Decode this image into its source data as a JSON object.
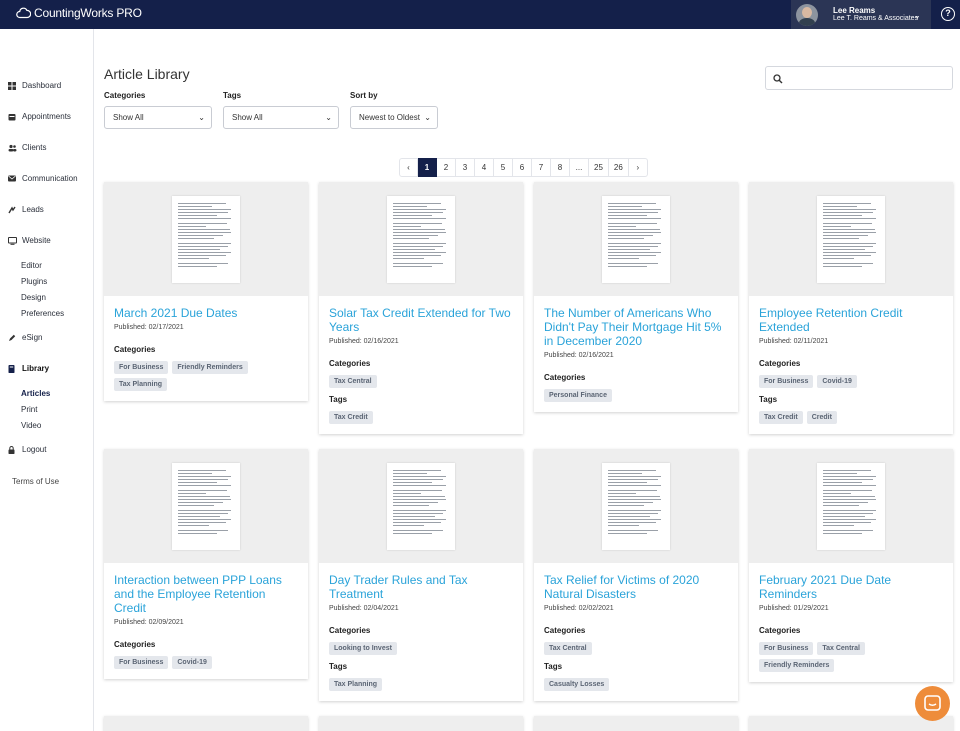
{
  "app": {
    "logo_text": "CountingWorks PRO"
  },
  "user": {
    "name": "Lee Reams",
    "firm": "Lee T. Reams & Associates"
  },
  "sidebar": {
    "items": [
      {
        "label": "Dashboard",
        "icon": "dashboard-icon"
      },
      {
        "label": "Appointments",
        "icon": "calendar-icon"
      },
      {
        "label": "Clients",
        "icon": "users-icon"
      },
      {
        "label": "Communication",
        "icon": "envelope-icon"
      },
      {
        "label": "Leads",
        "icon": "leads-icon"
      },
      {
        "label": "Website",
        "icon": "monitor-icon"
      },
      {
        "label": "eSign",
        "icon": "pen-icon"
      },
      {
        "label": "Library",
        "icon": "book-icon"
      },
      {
        "label": "Logout",
        "icon": "lock-icon"
      }
    ],
    "website_sub": [
      "Editor",
      "Plugins",
      "Design",
      "Preferences"
    ],
    "library_sub": [
      "Articles",
      "Print",
      "Video"
    ],
    "terms": "Terms of Use"
  },
  "main": {
    "title": "Article Library",
    "filters": {
      "categories_label": "Categories",
      "categories_value": "Show All",
      "tags_label": "Tags",
      "tags_value": "Show All",
      "sort_label": "Sort by",
      "sort_value": "Newest to Oldest"
    },
    "pagination": [
      "‹",
      "1",
      "2",
      "3",
      "4",
      "5",
      "6",
      "7",
      "8",
      "...",
      "25",
      "26",
      "›"
    ],
    "pagination_current": "1",
    "section_labels": {
      "categories": "Categories",
      "tags": "Tags"
    },
    "articles": [
      {
        "title": "March 2021 Due Dates",
        "date": "Published: 02/17/2021",
        "categories": [
          "For Business",
          "Friendly Reminders",
          "Tax Planning"
        ],
        "tags": []
      },
      {
        "title": "Solar Tax Credit Extended for Two Years",
        "date": "Published: 02/16/2021",
        "categories": [
          "Tax Central"
        ],
        "tags": [
          "Tax Credit"
        ]
      },
      {
        "title": "The Number of Americans Who Didn't Pay Their Mortgage Hit 5% in December 2020",
        "date": "Published: 02/16/2021",
        "categories": [
          "Personal Finance"
        ],
        "tags": []
      },
      {
        "title": "Employee Retention Credit Extended",
        "date": "Published: 02/11/2021",
        "categories": [
          "For Business",
          "Covid-19"
        ],
        "tags": [
          "Tax Credit",
          "Credit"
        ]
      },
      {
        "title": "Interaction between PPP Loans and the Employee Retention Credit",
        "date": "Published: 02/09/2021",
        "categories": [
          "For Business",
          "Covid-19"
        ],
        "tags": []
      },
      {
        "title": "Day Trader Rules and Tax Treatment",
        "date": "Published: 02/04/2021",
        "categories": [
          "Looking to Invest"
        ],
        "tags": [
          "Tax Planning"
        ]
      },
      {
        "title": "Tax Relief for Victims of 2020 Natural Disasters",
        "date": "Published: 02/02/2021",
        "categories": [
          "Tax Central"
        ],
        "tags": [
          "Casualty Losses"
        ]
      },
      {
        "title": "February 2021 Due Date Reminders",
        "date": "Published: 01/29/2021",
        "categories": [
          "For Business",
          "Tax Central",
          "Friendly Reminders"
        ],
        "tags": []
      }
    ]
  },
  "colors": {
    "navbar": "#14204a",
    "link": "#2aa3d9",
    "chat": "#ee8c3a"
  }
}
